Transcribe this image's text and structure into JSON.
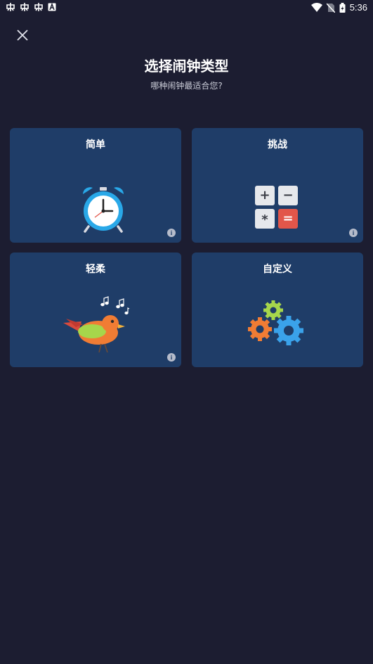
{
  "status_bar": {
    "time": "5:36",
    "left_icons": [
      "notification-icon",
      "notification-icon",
      "notification-icon",
      "a-letter-icon"
    ],
    "right_icons": [
      "wifi-icon",
      "no-sim-icon",
      "battery-charging-icon"
    ]
  },
  "header": {
    "title": "选择闹钟类型",
    "subtitle": "哪种闹钟最适合您?"
  },
  "cards": [
    {
      "label": "简单",
      "icon": "alarm-clock-icon",
      "has_info": true
    },
    {
      "label": "挑战",
      "icon": "calculator-icon",
      "has_info": true
    },
    {
      "label": "轻柔",
      "icon": "singing-bird-icon",
      "has_info": true
    },
    {
      "label": "自定义",
      "icon": "gears-icon",
      "has_info": false
    }
  ],
  "calculator_keys": [
    "+",
    "−",
    "*",
    "="
  ],
  "info_glyph": "i",
  "colors": {
    "background": "#1c1d31",
    "card": "#1f3d68",
    "clock_blue": "#29a8e8",
    "equals_red": "#e2564a",
    "gear_green": "#a6d64b",
    "gear_orange": "#f07c34",
    "gear_blue": "#3aa2ea"
  }
}
